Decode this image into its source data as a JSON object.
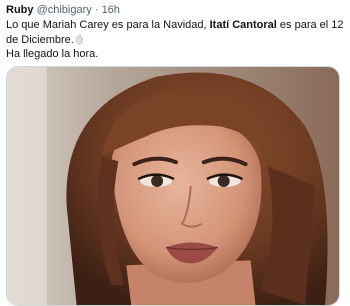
{
  "tweet": {
    "display_name": "Ruby",
    "handle": "@chibigary",
    "separator": "·",
    "time": "16h",
    "text_prefix": "Lo que Mariah Carey es para la Navidad, ",
    "mention": "Itatí Cantoral",
    "text_suffix": " es para el 12 de Diciembre.",
    "line2": "Ha llegado la hora.",
    "emoji_name": "hand-icon"
  },
  "media": {
    "skin_color": "#d9a086",
    "hair_color": "#6b3a22",
    "background_color": "#c9bfb6",
    "lip_color": "#9c4a46"
  }
}
